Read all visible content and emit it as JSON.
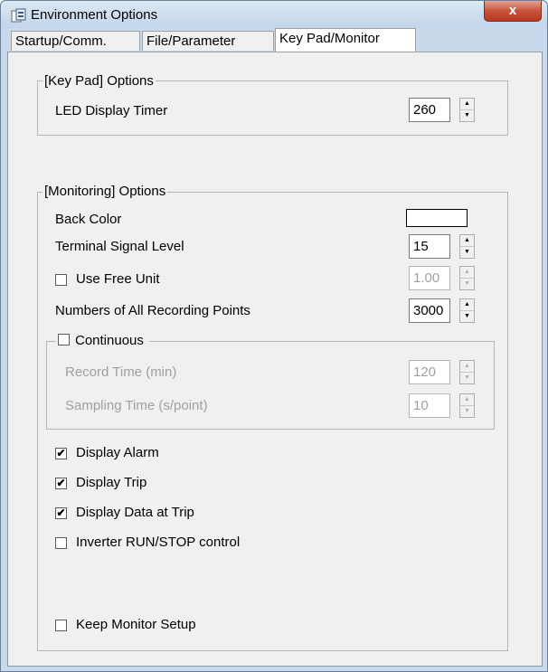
{
  "window": {
    "title": "Environment Options",
    "close_label": "x"
  },
  "tabs": [
    {
      "label": "Startup/Comm.",
      "selected": false
    },
    {
      "label": "File/Parameter",
      "selected": false
    },
    {
      "label": "Key Pad/Monitor",
      "selected": true
    }
  ],
  "keypad": {
    "legend": "[Key Pad] Options",
    "led_label": "LED Display Timer",
    "led_value": "260"
  },
  "monitoring": {
    "legend": "[Monitoring] Options",
    "back_color_label": "Back Color",
    "back_color_value": "#ffffff",
    "signal_label": "Terminal Signal Level",
    "signal_value": "15",
    "free_unit_label": "Use Free Unit",
    "free_unit_checked": false,
    "free_unit_value": "1.00",
    "points_label": "Numbers of All Recording Points",
    "points_value": "3000",
    "continuous": {
      "legend": "Continuous",
      "checked": false,
      "record_label": "Record Time (min)",
      "record_value": "120",
      "sampling_label": "Sampling Time (s/point)",
      "sampling_value": "10"
    },
    "checks": [
      {
        "label": "Display Alarm",
        "checked": true
      },
      {
        "label": "Display Trip",
        "checked": true
      },
      {
        "label": "Display Data at Trip",
        "checked": true
      },
      {
        "label": "Inverter RUN/STOP control",
        "checked": false
      }
    ],
    "keep_setup_label": "Keep Monitor Setup",
    "keep_setup_checked": false,
    "check_mark": "✔"
  }
}
